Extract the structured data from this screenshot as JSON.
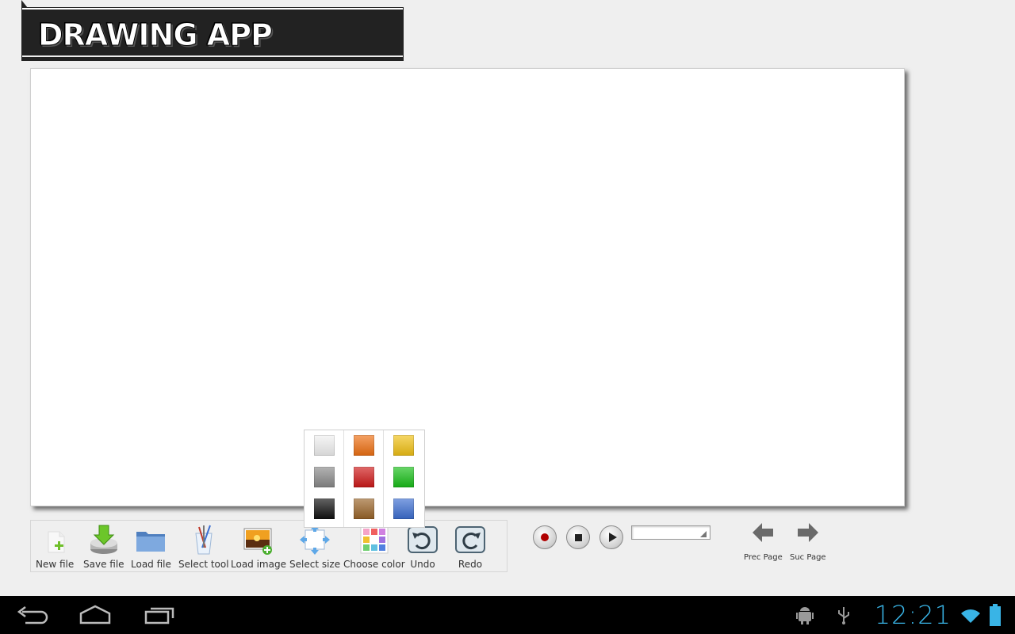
{
  "app": {
    "title": "DRAWING APP"
  },
  "toolbar": {
    "items": [
      {
        "label": "New file",
        "icon": "new-file-icon"
      },
      {
        "label": "Save file",
        "icon": "save-file-icon"
      },
      {
        "label": "Load file",
        "icon": "folder-icon"
      },
      {
        "label": "Select tool",
        "icon": "brush-cup-icon"
      },
      {
        "label": "Load image",
        "icon": "image-add-icon"
      },
      {
        "label": "Select size",
        "icon": "resize-arrows-icon"
      },
      {
        "label": "Choose color",
        "icon": "color-palette-icon"
      },
      {
        "label": "Undo",
        "icon": "undo-icon"
      },
      {
        "label": "Redo",
        "icon": "redo-icon"
      }
    ]
  },
  "color_palette": {
    "colors": [
      "#f2f2f2",
      "#f07012",
      "#f2c214",
      "#8a8a8a",
      "#d01818",
      "#18c018",
      "#101010",
      "#9a6428",
      "#3c6ed2"
    ]
  },
  "recording": {
    "record": "record-icon",
    "stop": "stop-icon",
    "play": "play-icon",
    "selected_value": ""
  },
  "page_nav": {
    "prev_label": "Prec Page",
    "next_label": "Suc Page"
  },
  "system_bar": {
    "time": "12:21",
    "accent": "#39b4e6"
  }
}
